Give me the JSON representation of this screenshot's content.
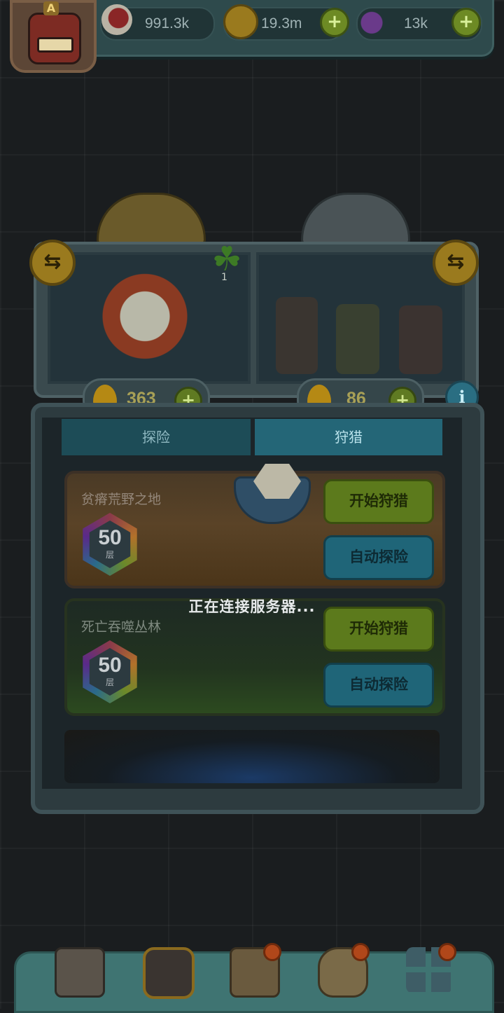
{
  "resources": {
    "eyeball": {
      "icon": "eyeball-icon",
      "value": "991.3k"
    },
    "gold": {
      "icon": "gold-coin-icon",
      "value": "19.3m"
    },
    "potion": {
      "icon": "potion-icon",
      "value": "13k"
    },
    "plus": "+"
  },
  "clover": {
    "icon": "clover-icon",
    "glyph": "☘",
    "count": "1"
  },
  "drops": {
    "left": {
      "icon": "drop-icon",
      "value": "363"
    },
    "right": {
      "icon": "drop-icon",
      "value": "86"
    },
    "plus": "+",
    "info": "i"
  },
  "tabs": {
    "explore": "探险",
    "hunt": "狩猎"
  },
  "stages": [
    {
      "name": "贫瘠荒野之地",
      "floor": "50",
      "floor_unit": "层",
      "hunt_label": "开始狩猎",
      "auto_label": "自动探险"
    },
    {
      "name": "死亡吞噬丛林",
      "floor": "50",
      "floor_unit": "层",
      "hunt_label": "开始狩猎",
      "auto_label": "自动探险"
    }
  ],
  "loading_text": "正在连接服务器...",
  "swap_glyph": "⇆",
  "avatar_badge": "A",
  "colors": {
    "gold": "#9a7a1e",
    "hunt_button": "#5c7a1c",
    "auto_button": "#1f6578",
    "nav_bar": "#3f7472"
  },
  "nav": [
    {
      "icon": "shop-icon"
    },
    {
      "icon": "monster-icon",
      "active": true
    },
    {
      "icon": "book-icon",
      "badge": true
    },
    {
      "icon": "money-bag-icon",
      "badge": true
    },
    {
      "icon": "grid-menu-icon",
      "badge": true
    }
  ]
}
